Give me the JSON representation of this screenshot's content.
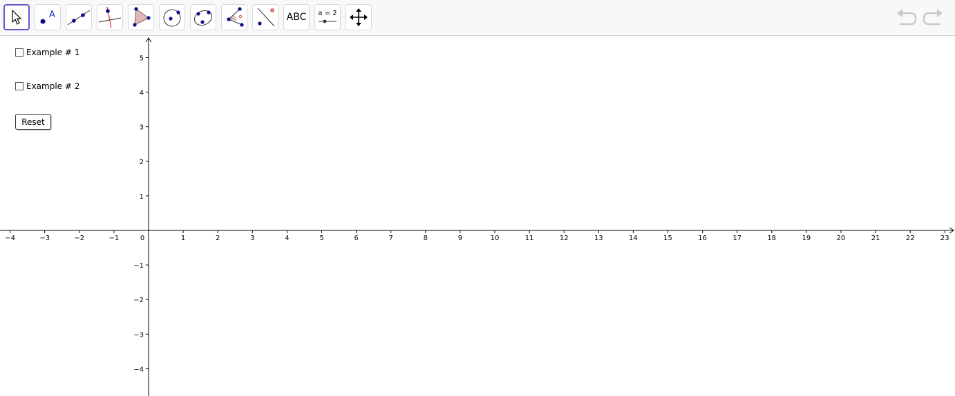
{
  "toolbar": {
    "tools": [
      {
        "name": "move-tool",
        "icon": "arrow-pointer-icon"
      },
      {
        "name": "point-tool",
        "icon": "point-a-icon",
        "label": "A"
      },
      {
        "name": "line-tool",
        "icon": "line-through-points-icon"
      },
      {
        "name": "perpendicular-line-tool",
        "icon": "perpendicular-line-icon"
      },
      {
        "name": "polygon-tool",
        "icon": "polygon-icon"
      },
      {
        "name": "circle-tool",
        "icon": "circle-center-point-icon"
      },
      {
        "name": "conic-tool",
        "icon": "ellipse-icon"
      },
      {
        "name": "angle-tool",
        "icon": "angle-icon"
      },
      {
        "name": "reflect-tool",
        "icon": "reflect-about-line-icon"
      },
      {
        "name": "text-tool",
        "icon": "text-icon",
        "label": "ABC"
      },
      {
        "name": "slider-tool",
        "icon": "slider-icon",
        "label": "a = 2"
      },
      {
        "name": "move-graphics-view-tool",
        "icon": "move-arrows-icon"
      }
    ],
    "active_tool": 0,
    "undo_icon": "undo-icon",
    "redo_icon": "redo-icon"
  },
  "controls": {
    "checkbox1_label": "Example # 1",
    "checkbox2_label": "Example # 2",
    "reset_label": "Reset"
  },
  "graph": {
    "x_ticks": [
      "−4",
      "−3",
      "−2",
      "−1",
      "1",
      "2",
      "3",
      "4",
      "5",
      "6",
      "7",
      "8",
      "9",
      "10",
      "11",
      "12",
      "13",
      "14",
      "15",
      "16",
      "17",
      "18",
      "19",
      "20",
      "21",
      "22",
      "23"
    ],
    "x_tick_values": [
      -4,
      -3,
      -2,
      -1,
      1,
      2,
      3,
      4,
      5,
      6,
      7,
      8,
      9,
      10,
      11,
      12,
      13,
      14,
      15,
      16,
      17,
      18,
      19,
      20,
      21,
      22,
      23
    ],
    "y_ticks": [
      "5",
      "4",
      "3",
      "2",
      "1",
      "−1",
      "−2",
      "−3",
      "−4"
    ],
    "y_tick_values": [
      5,
      4,
      3,
      2,
      1,
      -1,
      -2,
      -3,
      -4
    ],
    "origin_label": "0",
    "colors": {
      "accent": "#6557d2",
      "point": "#0b0b8a",
      "fill": "#e0b8b8",
      "red": "#cc3322"
    }
  }
}
